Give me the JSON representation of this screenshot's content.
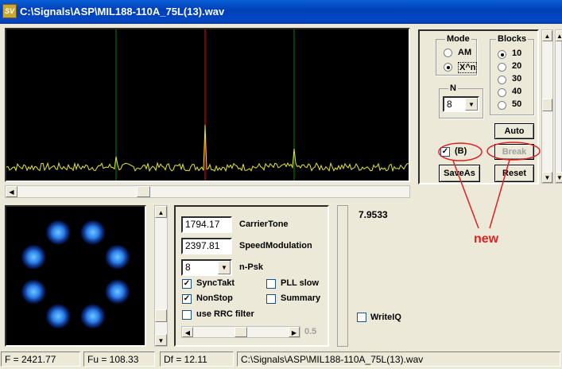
{
  "window": {
    "title": "C:\\Signals\\ASP\\MIL188-110A_75L(13).wav",
    "logo": "SV"
  },
  "colors": {
    "spectrum_bg": "#000000",
    "spectrum_trace": "#e8e820",
    "marker_green": "#008000",
    "marker_red": "#ff0000",
    "annotation_red": "#e02020"
  },
  "mode": {
    "title": "Mode",
    "options": [
      "AM",
      "X^n"
    ],
    "selected": "X^n"
  },
  "blocks": {
    "title": "Blocks",
    "options": [
      "10",
      "20",
      "30",
      "40",
      "50"
    ],
    "selected": "10"
  },
  "n": {
    "title": "N",
    "value": "8"
  },
  "buttons": {
    "auto": "Auto",
    "break": "Break",
    "saveas": "SaveAs",
    "reset": "Reset"
  },
  "b_checkbox": {
    "label": "(B)",
    "checked": true
  },
  "params": {
    "carrier_tone_value": "1794.17",
    "carrier_tone_label": "CarrierTone",
    "speed_mod_value": "2397.81",
    "speed_mod_label": "SpeedModulation",
    "npsk_value": "8",
    "npsk_label": "n-Psk",
    "sync_takt": "SyncTakt",
    "non_stop": "NonStop",
    "use_rrc": "use RRC filter",
    "pll_slow": "PLL slow",
    "summary": "Summary",
    "slider_value": "0.5"
  },
  "readout": "7.9533",
  "write_iq": "WriteIQ",
  "annotation": "new",
  "status": {
    "f": "F = 2421.77",
    "fu": "Fu = 108.33",
    "df": "Df = 12.11",
    "file": "C:\\Signals\\ASP\\MIL188-110A_75L(13).wav"
  }
}
